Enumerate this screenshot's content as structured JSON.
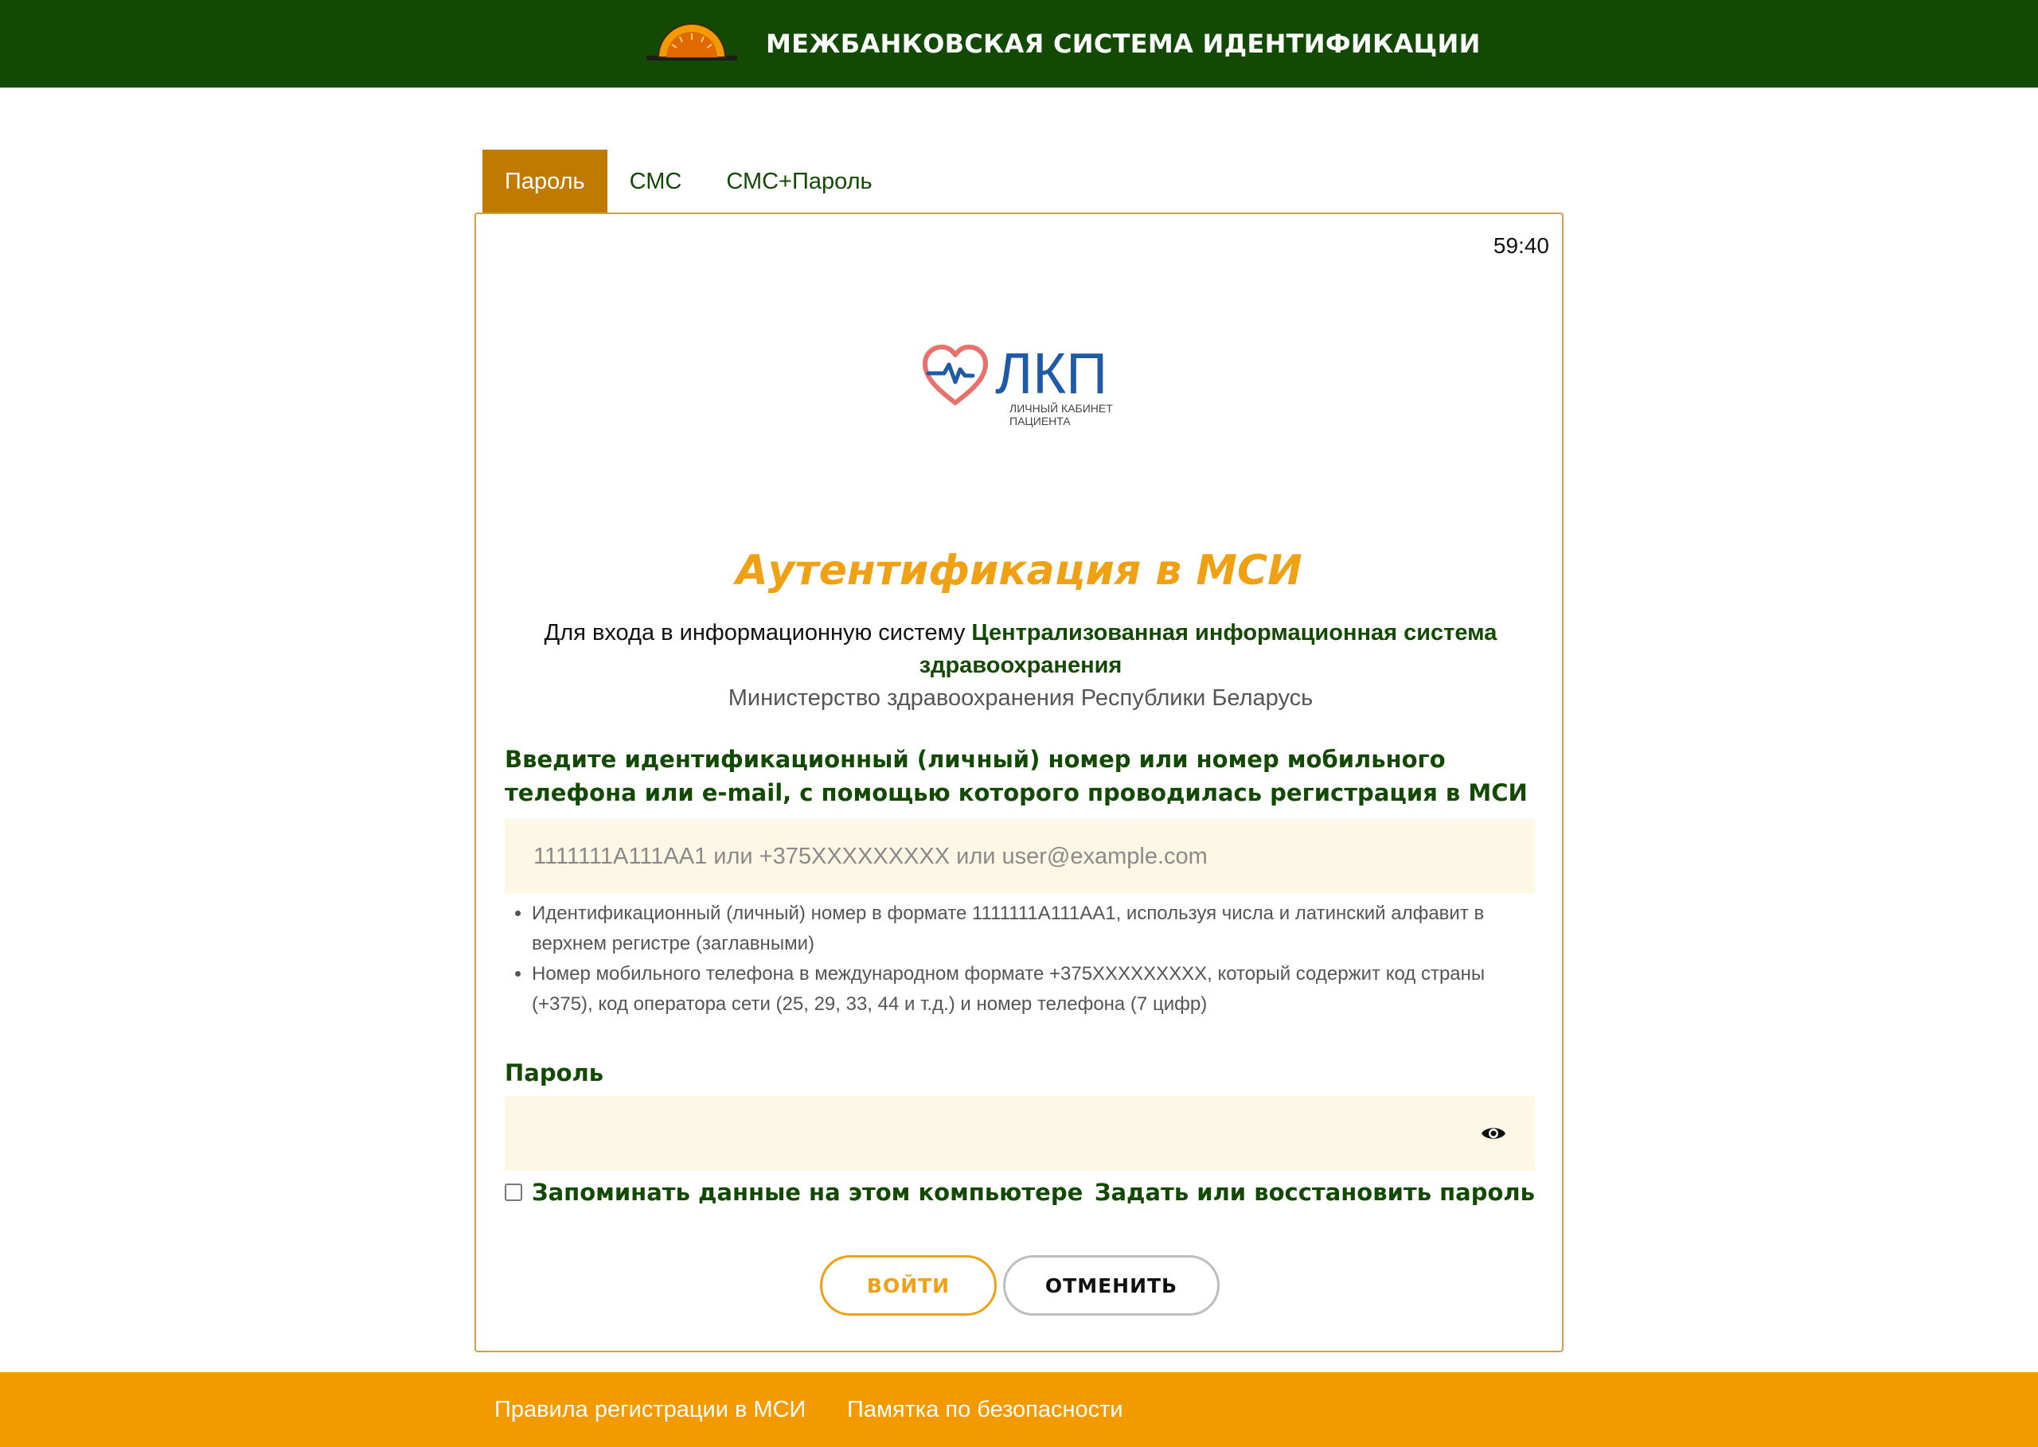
{
  "header": {
    "title": "МЕЖБАНКОВСКАЯ СИСТЕМА ИДЕНТИФИКАЦИИ",
    "logo_icon": "sunrise-logo-icon",
    "background": "#124a03"
  },
  "tabs": [
    {
      "label": "Пароль",
      "active": true
    },
    {
      "label": "СМС",
      "active": false
    },
    {
      "label": "СМС+Пароль",
      "active": false
    }
  ],
  "card": {
    "timer": "59:40",
    "service_logo": {
      "name": "ЛКП",
      "line1": "ЛИЧНЫЙ КАБИНЕТ",
      "line2": "ПАЦИЕНТА"
    },
    "title": "Аутентификация в МСИ",
    "intro": {
      "prefix": "Для входа в информационную систему ",
      "system_name": "Централизованная информационная система здравоохранения",
      "ministry": "Министерство здравоохранения Республики Беларусь"
    },
    "identifier": {
      "label": "Введите идентификационный (личный) номер или номер мобильного телефона или e-mail, с помощью которого проводилась регистрация в МСИ",
      "value": "",
      "placeholder": "1111111A111AA1 или +375XXXXXXXXX или user@example.com",
      "hints": [
        "Идентификационный (личный) номер в формате 1111111A111AA1, используя числа и латинский алфавит в верхнем регистре (заглавными)",
        "Номер мобильного телефона в международном формате +375XXXXXXXXX, который содержит код страны (+375), код оператора сети (25, 29, 33, 44 и т.д.) и номер телефона (7 цифр)"
      ]
    },
    "password": {
      "label": "Пароль",
      "value": "",
      "toggle_icon": "eye-icon"
    },
    "remember_label": "Запоминать данные на этом компьютере",
    "remember_checked": false,
    "restore_link": "Задать или восстановить пароль",
    "login_button": "ВОЙТИ",
    "cancel_button": "ОТМЕНИТЬ"
  },
  "footer": {
    "links": [
      "Правила регистрации в МСИ",
      "Памятка по безопасности"
    ],
    "background": "#f39a00"
  },
  "colors": {
    "accent_orange": "#f0a013",
    "active_tab": "#c07a00",
    "dark_green": "#124a03",
    "input_bg": "#fdf7e5"
  }
}
